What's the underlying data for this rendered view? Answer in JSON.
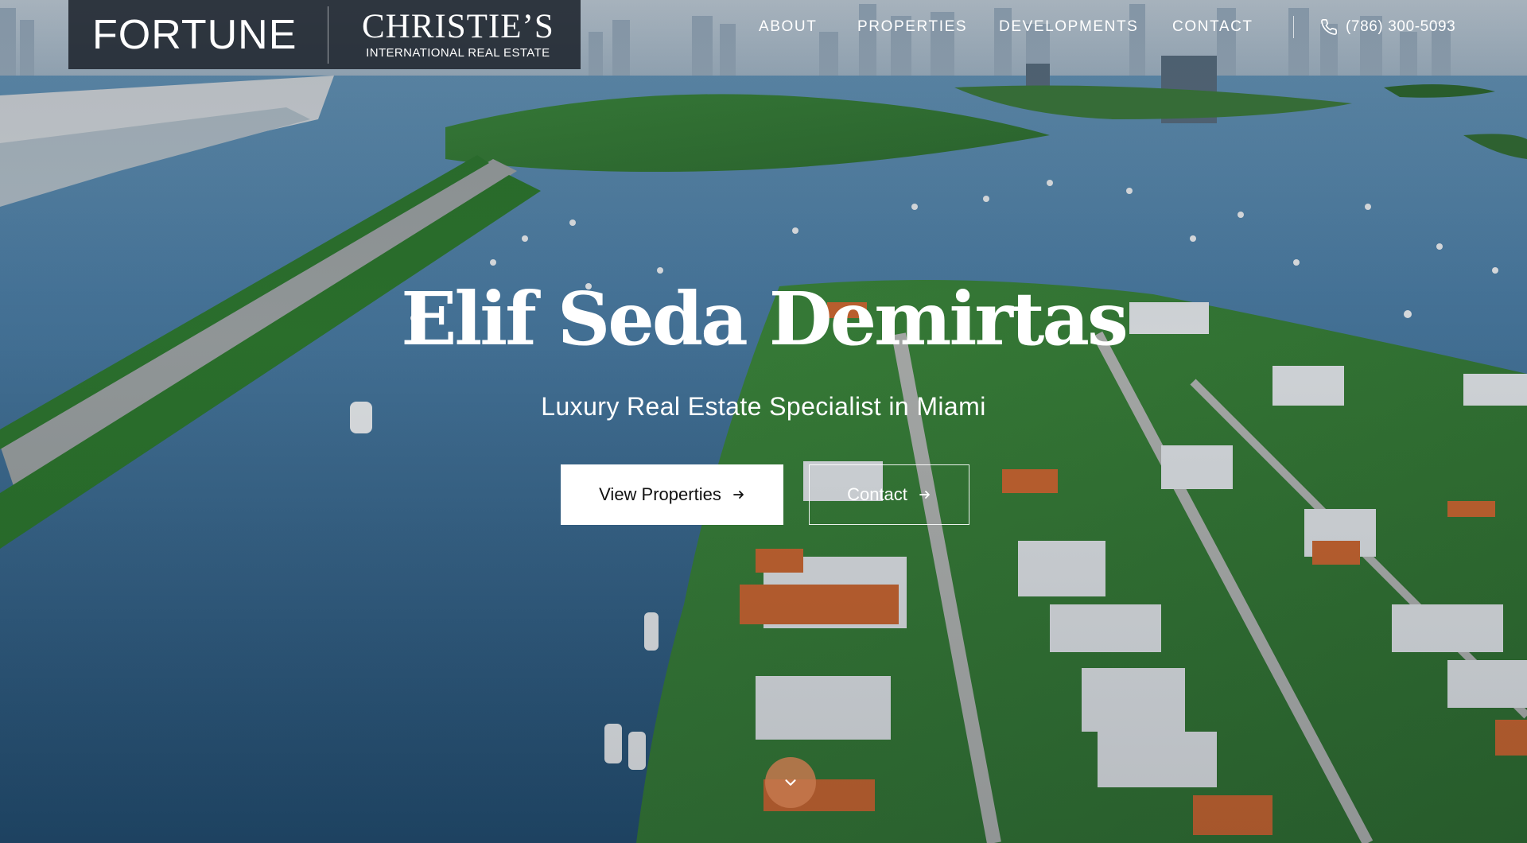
{
  "header": {
    "logo": {
      "primary": "FORTUNE",
      "secondary_name": "CHRISTIE’S",
      "secondary_sub": "INTERNATIONAL REAL ESTATE"
    },
    "nav": [
      {
        "label": "ABOUT"
      },
      {
        "label": "PROPERTIES"
      },
      {
        "label": "DEVELOPMENTS"
      },
      {
        "label": "CONTACT"
      }
    ],
    "phone": {
      "icon": "phone-icon",
      "number": "(786) 300-5093"
    }
  },
  "hero": {
    "title": "Elif Seda Demirtas",
    "tagline": "Luxury Real Estate Specialist in Miami",
    "primary_button": "View Properties",
    "secondary_button": "Contact",
    "button_icon": "arrow-right-icon",
    "scroll_icon": "chevron-down-icon",
    "scroll_color": "#c6784e",
    "background": "aerial view of Miami islands and bay"
  }
}
